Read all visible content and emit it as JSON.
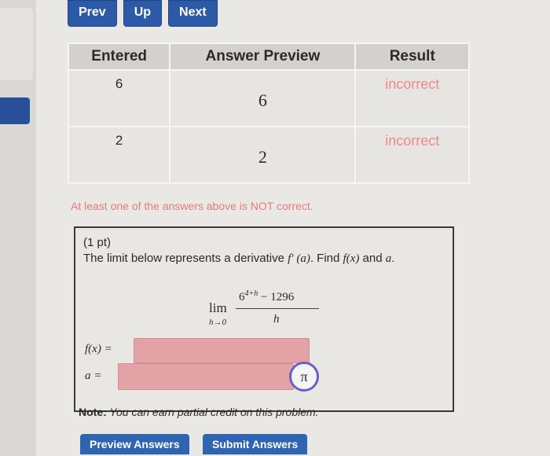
{
  "nav": {
    "prev": "Prev",
    "up": "Up",
    "next": "Next"
  },
  "table": {
    "headers": [
      "Entered",
      "Answer Preview",
      "Result"
    ],
    "rows": [
      {
        "entered": "6",
        "preview": "6",
        "result": "incorrect"
      },
      {
        "entered": "2",
        "preview": "2",
        "result": "incorrect"
      }
    ]
  },
  "warning": "At least one of the answers above is NOT correct.",
  "problem": {
    "points": "(1 pt)",
    "prompt_start": "The limit below represents a derivative ",
    "prompt_fprime": "f′ (a)",
    "prompt_mid": ". Find ",
    "prompt_fx": "f(x)",
    "prompt_and": " and ",
    "prompt_a": "a",
    "prompt_end": ".",
    "lim": "lim",
    "lim_sub": "h→0",
    "numerator_base": "6",
    "numerator_exp": "4+h",
    "numerator_rest": " − 1296",
    "denominator": "h",
    "label_f": "f(x) =",
    "label_a": "a =",
    "f_value": "",
    "a_value": "",
    "pi_symbol": "π",
    "note_bold": "Note:",
    "note_text": " You can earn partial credit on this problem."
  },
  "buttons": {
    "preview": "Preview Answers",
    "submit": "Submit Answers"
  },
  "colors": {
    "accent": "#2c5aa6",
    "incorrect": "#f08a8a",
    "input_bg": "#e3a3a6"
  }
}
